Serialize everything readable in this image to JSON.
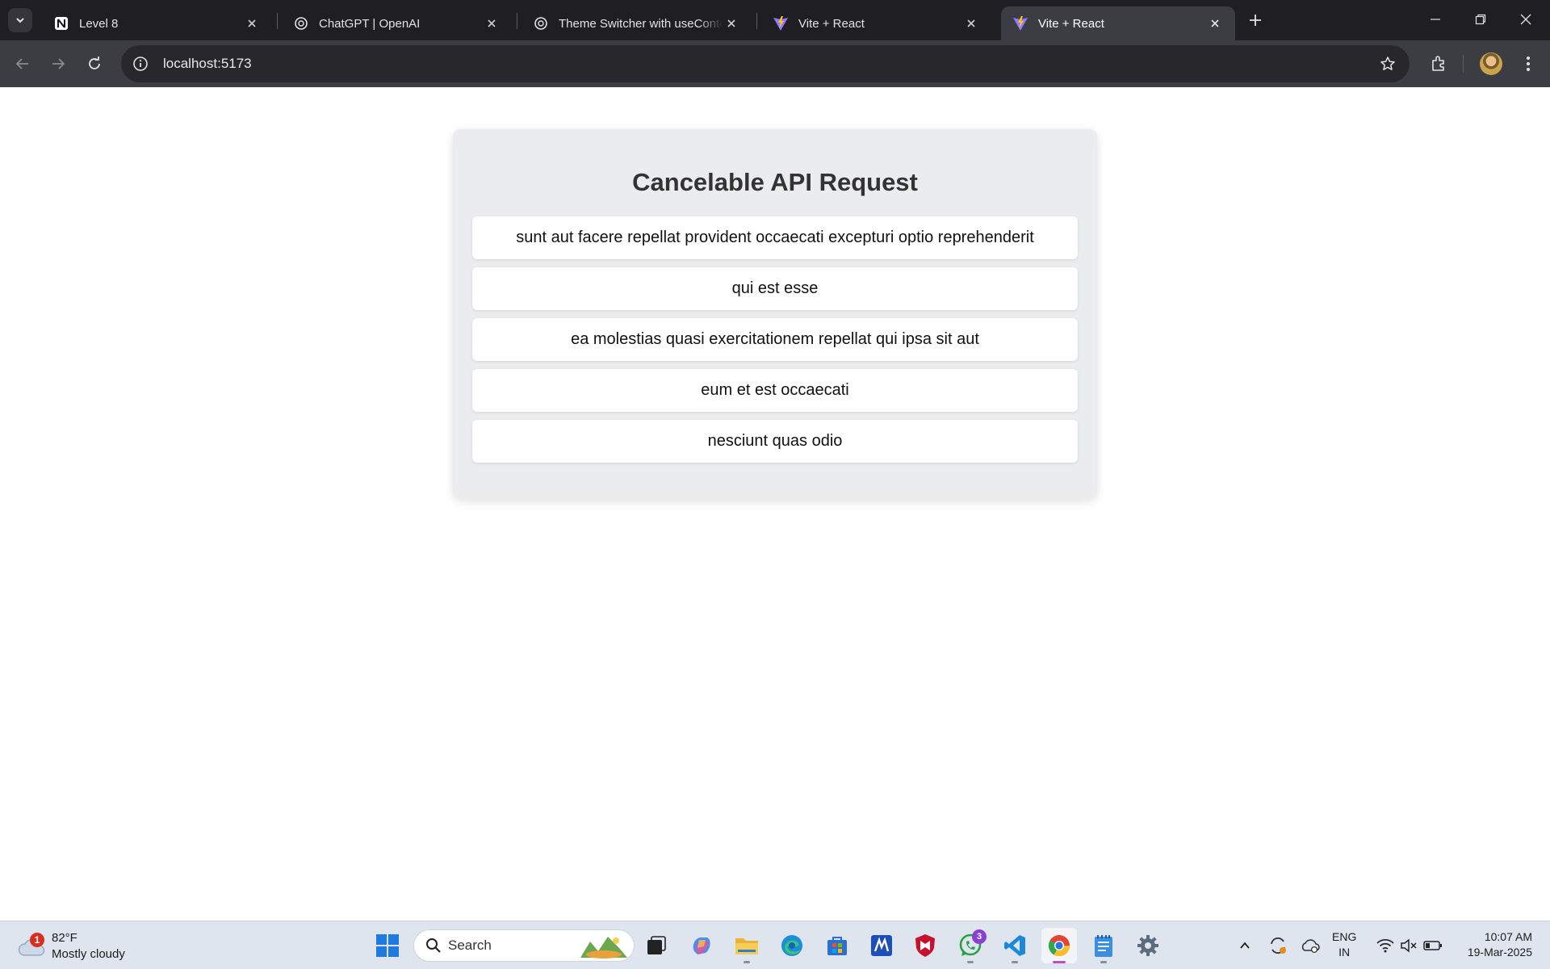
{
  "browser": {
    "tabs": [
      {
        "title": "Level 8",
        "icon": "notion-icon"
      },
      {
        "title": "ChatGPT | OpenAI",
        "icon": "openai-icon"
      },
      {
        "title": "Theme Switcher with useContext",
        "icon": "openai-icon"
      },
      {
        "title": "Vite + React",
        "icon": "vite-icon"
      },
      {
        "title": "Vite + React",
        "icon": "vite-icon",
        "active": true
      }
    ],
    "address": "localhost:5173"
  },
  "page": {
    "title": "Cancelable API Request",
    "posts": [
      "sunt aut facere repellat provident occaecati excepturi optio reprehenderit",
      "qui est esse",
      "ea molestias quasi exercitationem repellat qui ipsa sit aut",
      "eum et est occaecati",
      "nesciunt quas odio"
    ]
  },
  "taskbar": {
    "weather": {
      "temp": "82°F",
      "desc": "Mostly cloudy",
      "badge": "1"
    },
    "search_label": "Search",
    "whatsapp_badge": "3",
    "language": {
      "line1": "ENG",
      "line2": "IN"
    },
    "clock": {
      "time": "10:07 AM",
      "date": "19-Mar-2025"
    }
  },
  "colors": {
    "chrome_dark": "#1f1f23",
    "toolbar": "#3c3c43",
    "card_bg": "#ebecee",
    "title_text": "#333333",
    "taskbar_bg": "#dfe5ef"
  }
}
